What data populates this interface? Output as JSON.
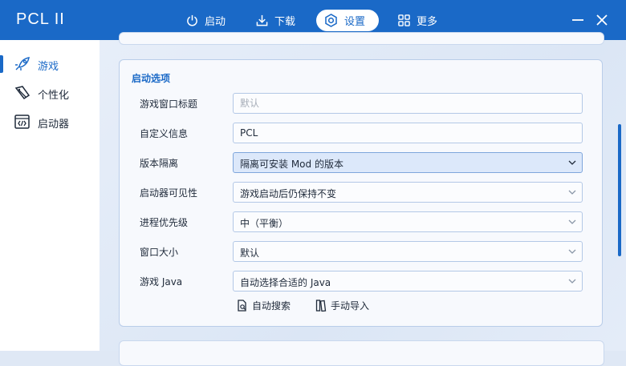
{
  "app": {
    "title": "PCL II"
  },
  "nav": {
    "items": [
      {
        "label": "启动",
        "icon": "power-icon"
      },
      {
        "label": "下载",
        "icon": "download-icon"
      },
      {
        "label": "设置",
        "icon": "gear-icon",
        "active": true
      },
      {
        "label": "更多",
        "icon": "grid-icon"
      }
    ]
  },
  "sidebar": {
    "items": [
      {
        "label": "游戏",
        "icon": "rocket-icon",
        "active": true
      },
      {
        "label": "个性化",
        "icon": "brush-icon"
      },
      {
        "label": "启动器",
        "icon": "code-window-icon"
      }
    ]
  },
  "section": {
    "title": "启动选项",
    "rows": [
      {
        "label": "游戏窗口标题",
        "type": "input",
        "value": "",
        "placeholder": "默认"
      },
      {
        "label": "自定义信息",
        "type": "input",
        "value": "PCL",
        "placeholder": ""
      },
      {
        "label": "版本隔离",
        "type": "select",
        "value": "隔离可安装 Mod 的版本"
      },
      {
        "label": "启动器可见性",
        "type": "select",
        "value": "游戏启动后仍保持不变"
      },
      {
        "label": "进程优先级",
        "type": "select",
        "value": "中（平衡）"
      },
      {
        "label": "窗口大小",
        "type": "select",
        "value": "默认"
      },
      {
        "label": "游戏 Java",
        "type": "select",
        "value": "自动选择合适的 Java"
      }
    ],
    "actions": {
      "auto_search": "自动搜索",
      "manual_import": "手动导入"
    }
  },
  "colors": {
    "accent": "#1a69c7",
    "sidebar_bg": "#ffffff",
    "card_bg": "#f7f9fd"
  }
}
